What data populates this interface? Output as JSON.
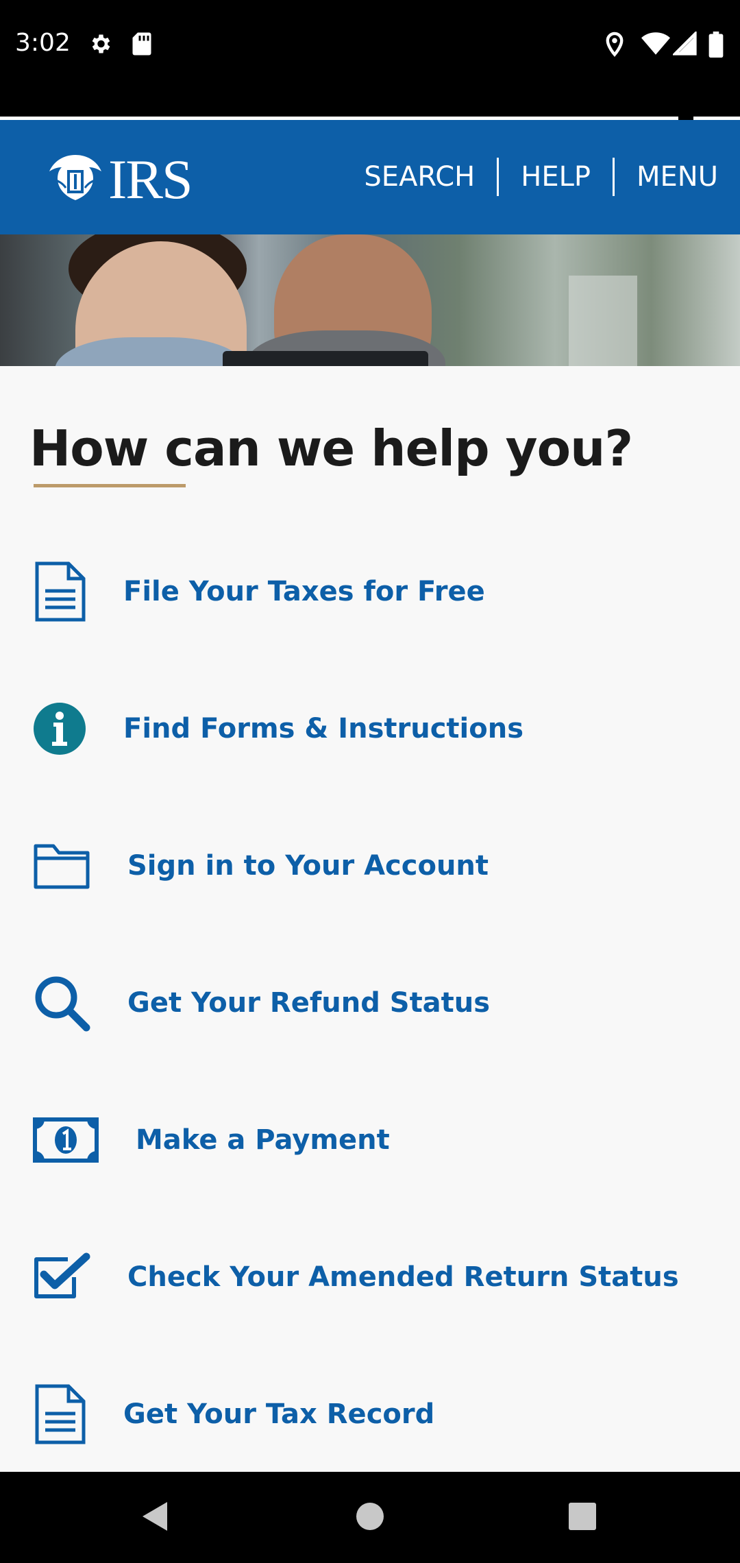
{
  "status_bar": {
    "time": "3:02",
    "icons": [
      "gear-icon",
      "sd-card-icon",
      "location-icon",
      "wifi-icon",
      "signal-icon",
      "battery-icon"
    ]
  },
  "header": {
    "logo_text": "IRS",
    "nav": [
      {
        "label": "SEARCH"
      },
      {
        "label": "HELP"
      },
      {
        "label": "MENU"
      }
    ]
  },
  "main": {
    "title": "How can we help you?",
    "items": [
      {
        "label": "File Your Taxes for Free",
        "icon": "document-icon"
      },
      {
        "label": "Find Forms & Instructions",
        "icon": "info-icon"
      },
      {
        "label": "Sign in to Your Account",
        "icon": "folder-icon"
      },
      {
        "label": "Get Your Refund Status",
        "icon": "search-icon"
      },
      {
        "label": "Make a Payment",
        "icon": "dollar-bill-icon"
      },
      {
        "label": "Check Your Amended Return Status",
        "icon": "checkbox-icon"
      },
      {
        "label": "Get Your Tax Record",
        "icon": "document-icon"
      }
    ]
  },
  "colors": {
    "brand_blue": "#0d5fa8",
    "accent_gold": "#bc9b6a",
    "info_teal": "#0f7b8e"
  }
}
